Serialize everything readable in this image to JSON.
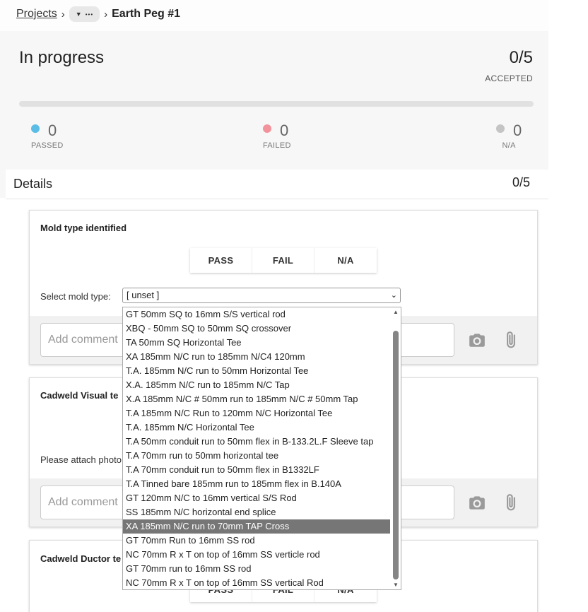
{
  "breadcrumb": {
    "root": "Projects",
    "ellipsis": "•••",
    "current": "Earth Peg #1"
  },
  "summary": {
    "status": "In progress",
    "accepted_count": "0/5",
    "accepted_label": "ACCEPTED",
    "progress_fraction": 0,
    "passed": {
      "value": "0",
      "label": "PASSED",
      "color": "#5bbde6"
    },
    "failed": {
      "value": "0",
      "label": "FAILED",
      "color": "#f2939c"
    },
    "na": {
      "value": "0",
      "label": "N/A",
      "color": "#c4c4c4"
    }
  },
  "details": {
    "title": "Details",
    "count": "0/5"
  },
  "buttons": {
    "pass": "PASS",
    "fail": "FAIL",
    "na": "N/A"
  },
  "cards": [
    {
      "title": "Mold type identified",
      "select_label": "Select mold type:",
      "select_value": "[ unset ]",
      "comment_placeholder": "Add comment"
    },
    {
      "title": "Cadweld Visual te",
      "photo_label": "Please attach photo",
      "comment_placeholder": "Add comment"
    },
    {
      "title": "Cadweld Ductor te"
    }
  ],
  "dropdown": {
    "selected_index": 15,
    "options": [
      "GT 50mm SQ to 16mm S/S vertical rod",
      "XBQ - 50mm SQ to 50mm SQ crossover",
      "TA 50mm SQ Horizontal Tee",
      "XA 185mm N/C run to 185mm N/C4 120mm",
      "T.A. 185mm N/C run to 50mm Horizontal Tee",
      "X.A. 185mm N/C run to 185mm N/C Tap",
      "X.A 185mm N/C # 50mm run to 185mm N/C # 50mm Tap",
      "T.A 185mm N/C Run to 120mm N/C Horizontal Tee",
      "T.A. 185mm N/C Horizontal Tee",
      "T.A 50mm conduit run to 50mm flex in B-133.2L.F Sleeve tap",
      "T.A 70mm run to 50mm horizontal tee",
      "T.A 70mm conduit run to 50mm flex in B1332LF",
      "T.A Tinned bare 185mm run to 185mm flex in B.140A",
      "GT 120mm N/C to 16mm vertical S/S Rod",
      "SS 185mm N/C horizontal end splice",
      "XA 185mm N/C run to 70mm TAP Cross",
      "GT 70mm Run to 16mm SS rod",
      "NC 70mm R x T on top of 16mm SS verticle rod",
      "GT 70mm run to 16mm SS rod",
      "NC 70mm R x T on top of 16mm SS vertical Rod"
    ]
  }
}
